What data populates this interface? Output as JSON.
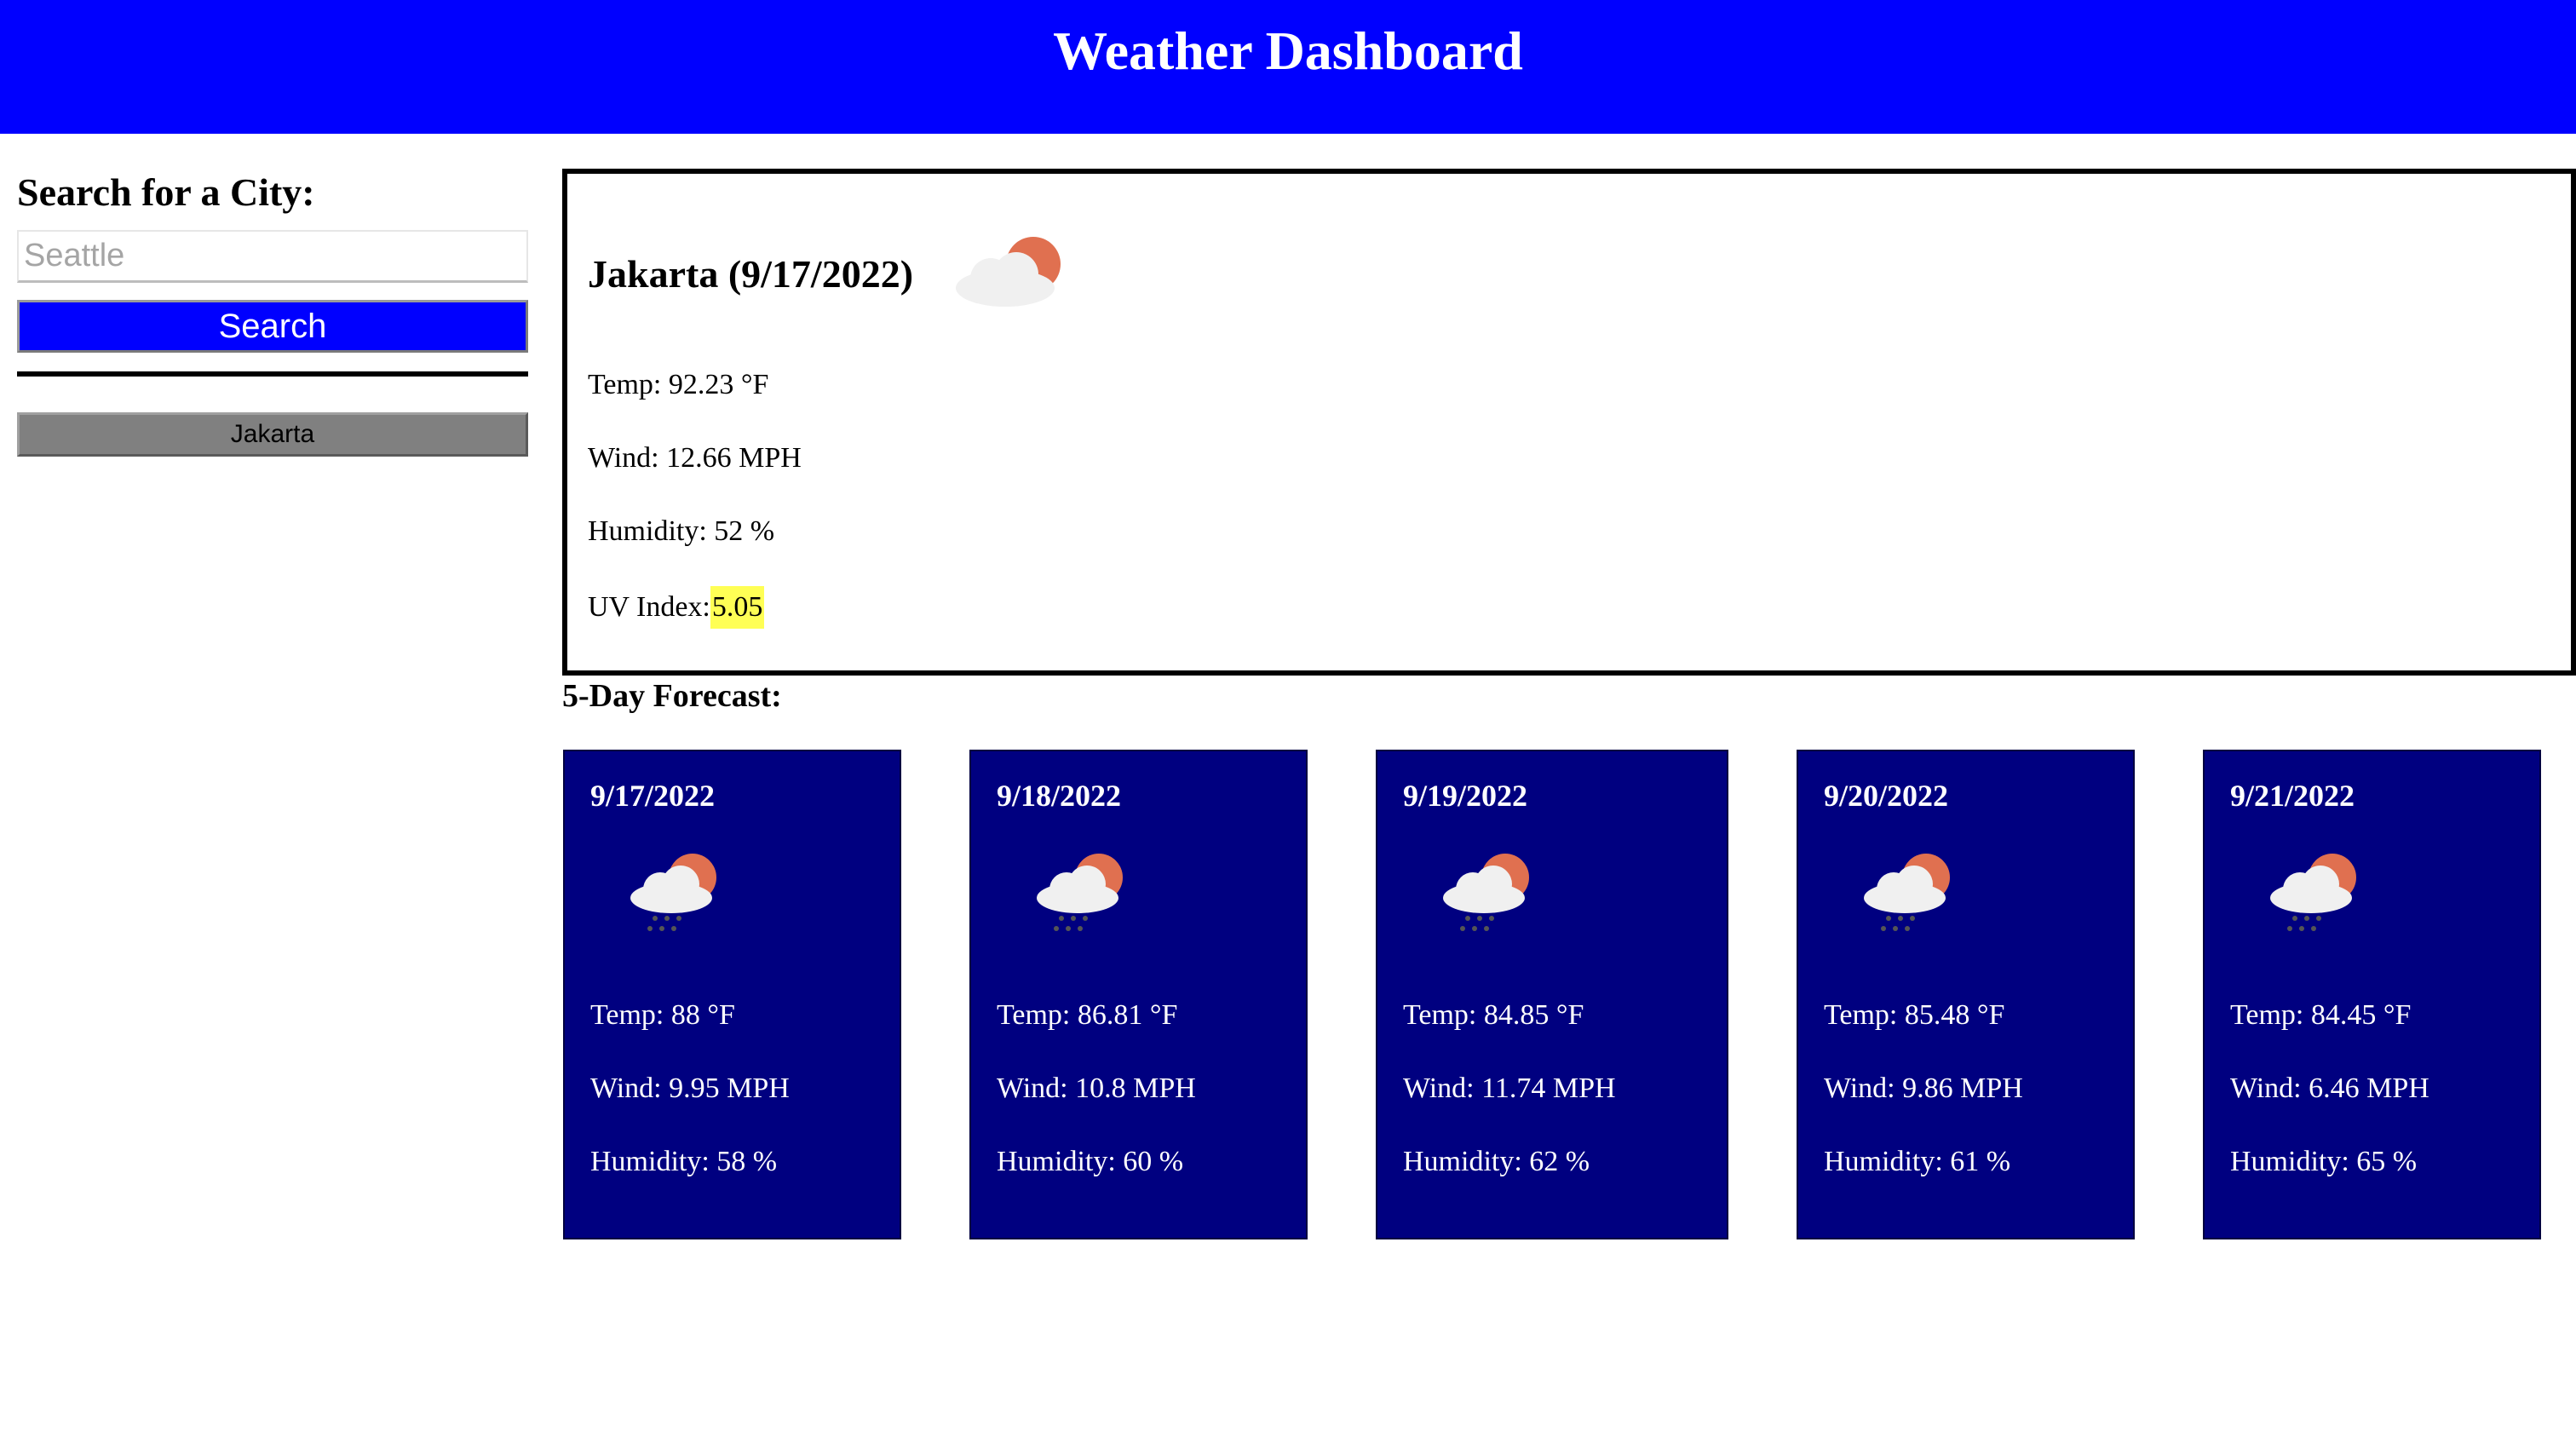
{
  "header": {
    "title": "Weather Dashboard"
  },
  "sidebar": {
    "heading": "Search for a City:",
    "search_placeholder": "Seattle",
    "search_value": "",
    "search_button_label": "Search",
    "history": [
      "Jakarta"
    ]
  },
  "current": {
    "title": "Jakarta (9/17/2022)",
    "icon": "cloud-sun-icon",
    "temp": "Temp: 92.23 °F",
    "wind": "Wind: 12.66 MPH",
    "humidity": "Humidity: 52 %",
    "uv_label": "UV Index:",
    "uv_value": "5.05",
    "uv_color": "#ffff55"
  },
  "forecast": {
    "heading": "5-Day Forecast:",
    "days": [
      {
        "date": "9/17/2022",
        "icon": "rain-cloud-sun-icon",
        "temp": "Temp: 88 °F",
        "wind": "Wind: 9.95 MPH",
        "humidity": "Humidity: 58 %"
      },
      {
        "date": "9/18/2022",
        "icon": "rain-cloud-sun-icon",
        "temp": "Temp: 86.81 °F",
        "wind": "Wind: 10.8 MPH",
        "humidity": "Humidity: 60 %"
      },
      {
        "date": "9/19/2022",
        "icon": "rain-cloud-sun-icon",
        "temp": "Temp: 84.85 °F",
        "wind": "Wind: 11.74 MPH",
        "humidity": "Humidity: 62 %"
      },
      {
        "date": "9/20/2022",
        "icon": "rain-cloud-sun-icon",
        "temp": "Temp: 85.48 °F",
        "wind": "Wind: 9.86 MPH",
        "humidity": "Humidity: 61 %"
      },
      {
        "date": "9/21/2022",
        "icon": "rain-cloud-sun-icon",
        "temp": "Temp: 84.45 °F",
        "wind": "Wind: 6.46 MPH",
        "humidity": "Humidity: 65 %"
      }
    ]
  },
  "colors": {
    "header_bg": "#0000ff",
    "search_button_bg": "#0000ff",
    "history_button_bg": "#808080",
    "card_bg": "#000080",
    "sun": "#e07050",
    "cloud": "#f0f0f0"
  }
}
